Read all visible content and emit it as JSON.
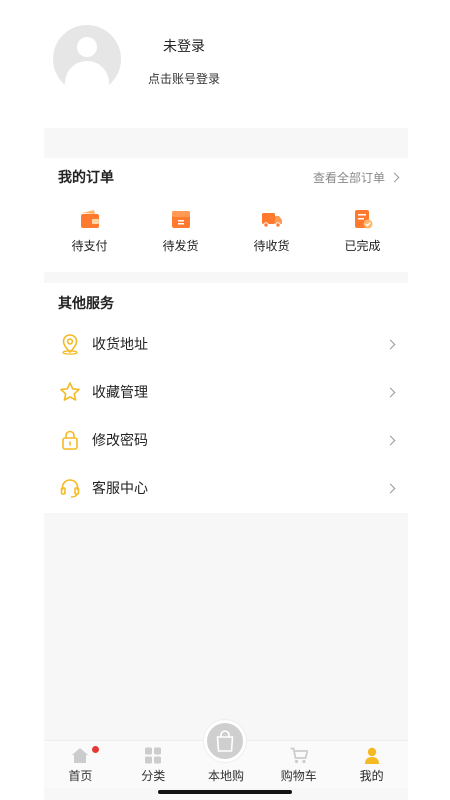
{
  "profile": {
    "title": "未登录",
    "subtitle": "点击账号登录"
  },
  "orders": {
    "title": "我的订单",
    "view_all": "查看全部订单",
    "items": [
      {
        "label": "待支付",
        "icon": "wallet-icon"
      },
      {
        "label": "待发货",
        "icon": "package-box-icon"
      },
      {
        "label": "待收货",
        "icon": "delivery-truck-icon"
      },
      {
        "label": "已完成",
        "icon": "completed-document-icon"
      }
    ]
  },
  "services": {
    "title": "其他服务",
    "items": [
      {
        "label": "收货地址",
        "icon": "location-pin-icon"
      },
      {
        "label": "收藏管理",
        "icon": "star-icon"
      },
      {
        "label": "修改密码",
        "icon": "lock-icon"
      },
      {
        "label": "客服中心",
        "icon": "headset-icon"
      }
    ]
  },
  "tabbar": {
    "items": [
      {
        "label": "首页",
        "icon": "home-icon",
        "badge": true
      },
      {
        "label": "分类",
        "icon": "grid-icon"
      },
      {
        "label": "本地购",
        "icon": "shopping-bag-icon"
      },
      {
        "label": "购物车",
        "icon": "cart-icon"
      },
      {
        "label": "我的",
        "icon": "user-icon",
        "active": true
      }
    ]
  },
  "colors": {
    "accent_orange": "#ff7a2f",
    "icon_yellow": "#f5b923",
    "badge_red": "#e53935"
  }
}
